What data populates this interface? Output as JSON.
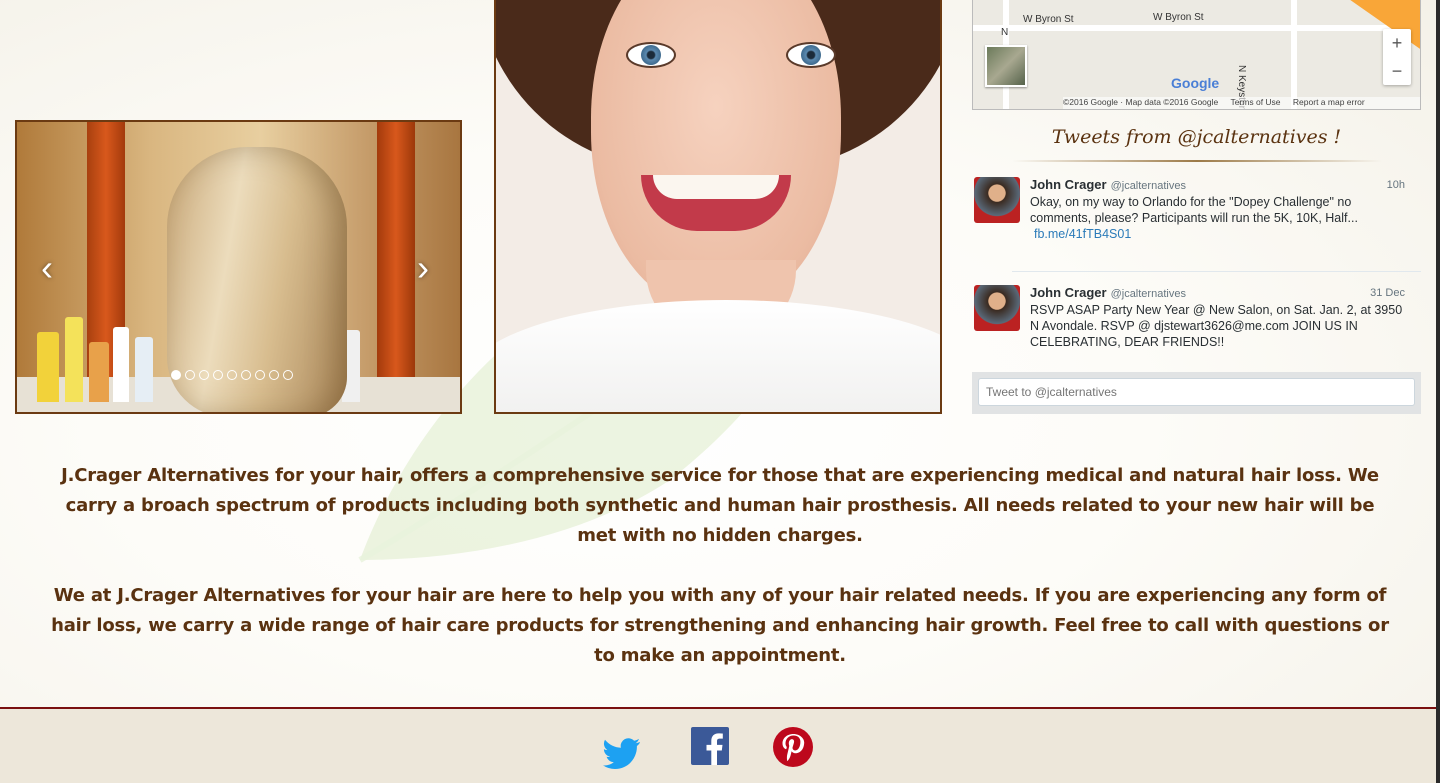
{
  "slider": {
    "prev_label": "‹",
    "next_label": "›",
    "dot_count": 9,
    "active_dot": 0
  },
  "map": {
    "streets": [
      "W Byron St",
      "W Byron St",
      "N Keystone Ave",
      "N"
    ],
    "zoom_in": "+",
    "zoom_out": "−",
    "logo": "Google",
    "copyright": "©2016 Google · Map data ©2016 Google",
    "terms": "Terms of Use",
    "report": "Report a map error"
  },
  "tweets": {
    "heading": "Tweets from @jcalternatives !",
    "items": [
      {
        "name": "John Crager",
        "handle": "@jcalternatives",
        "time": "10h",
        "text": "Okay, on my way to Orlando for the \"Dopey Challenge\" no comments, please? Participants will run the 5K, 10K, Half...",
        "link": "fb.me/41fTB4S01"
      },
      {
        "name": "John Crager",
        "handle": "@jcalternatives",
        "time": "31 Dec",
        "text": "RSVP ASAP Party New Year @ New Salon, on Sat. Jan. 2, at 3950 N Avondale. RSVP @ djstewart3626@me.com JOIN US IN CELEBRATING, DEAR FRIENDS!!",
        "link": ""
      }
    ],
    "compose_placeholder": "Tweet to @jcalternatives"
  },
  "content": {
    "paragraph_1": "J.Crager Alternatives for your hair, offers a comprehensive service for those that are experiencing medical and natural hair loss. We carry a broach spectrum of products including both synthetic and human hair prosthesis. All needs related to your new hair will be met with no hidden charges.",
    "paragraph_2": "We at J.Crager Alternatives for your hair are here to help you with any of your hair related needs. If you are experiencing any form of hair loss, we carry a wide range of hair care products for strengthening and enhancing hair growth. Feel free to call with questions or to make an appointment."
  },
  "footer": {
    "social": [
      {
        "name": "twitter-icon",
        "color": "#1da1f2"
      },
      {
        "name": "facebook-icon",
        "color": "#3b5998"
      },
      {
        "name": "pinterest-icon",
        "color": "#bd081c"
      }
    ]
  }
}
